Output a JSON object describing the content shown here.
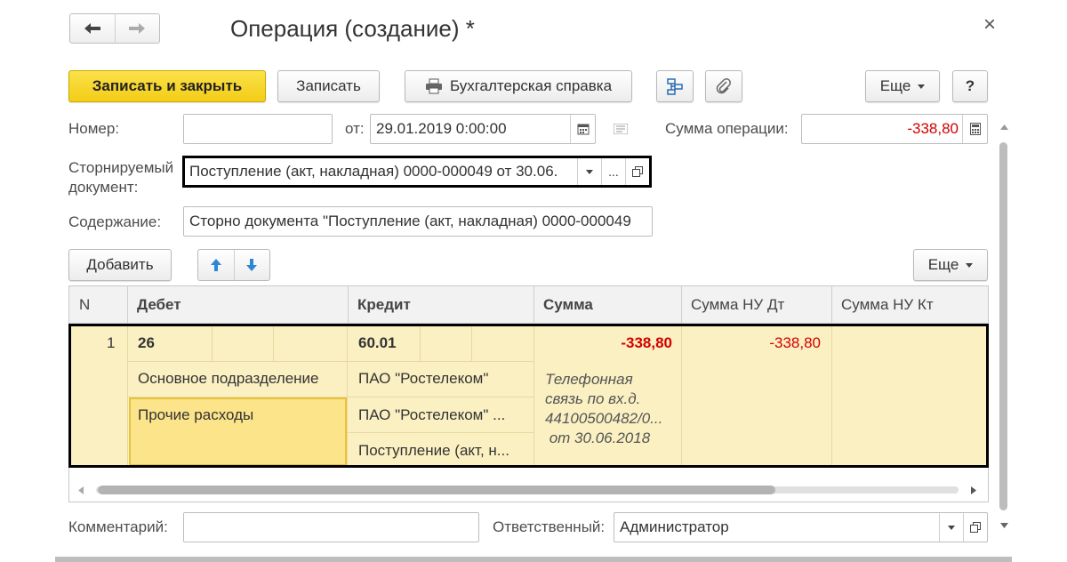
{
  "window": {
    "title": "Операция (создание) *",
    "close_glyph": "×"
  },
  "nav": {
    "back_glyph": "🡐",
    "forward_glyph": "🡒"
  },
  "toolbar": {
    "save_close_label": "Записать и закрыть",
    "save_label": "Записать",
    "report_label": "Бухгалтерская справка",
    "more_label": "Еще",
    "help_label": "?"
  },
  "form": {
    "number_label": "Номер:",
    "number_value": "",
    "date_label": "от:",
    "date_value": "29.01.2019  0:00:00",
    "sum_label": "Сумма операции:",
    "sum_value": "-338,80",
    "storno_label_line1": "Сторнируемый",
    "storno_label_line2": "документ:",
    "storno_value": "Поступление (акт, накладная) 0000-000049 от 30.06.",
    "storno_more_label": "...",
    "content_label": "Содержание:",
    "content_value": "Сторно документа \"Поступление (акт, накладная) 0000-000049"
  },
  "table_toolbar": {
    "add_label": "Добавить",
    "more_label": "Еще"
  },
  "table": {
    "columns": [
      "N",
      "Дебет",
      "Кредит",
      "Сумма",
      "Сумма НУ Дт",
      "Сумма НУ Кт"
    ],
    "row": {
      "n": "1",
      "debit_account": "26",
      "debit_subconto1": "Основное подразделение",
      "debit_subconto2": "Прочие расходы",
      "credit_account": "60.01",
      "credit_subconto1": "ПАО \"Ростелеком\"",
      "credit_subconto2": "ПАО \"Ростелеком\" ...",
      "credit_subconto3": "Поступление (акт, н...",
      "sum": "-338,80",
      "content_line1": "Телефонная",
      "content_line2": "связь по вх.д.",
      "content_line3": "44100500482/0...",
      "content_line4": " от 30.06.2018",
      "sum_nu_dt": "-338,80",
      "sum_nu_kt": ""
    }
  },
  "footer": {
    "comment_label": "Комментарий:",
    "comment_value": "",
    "responsible_label": "Ответственный:",
    "responsible_value": "Администратор"
  },
  "colors": {
    "accent_yellow": "#f7d52a",
    "row_selected": "#fbf0c2",
    "cell_current": "#fbe48a",
    "negative": "#d40000"
  }
}
